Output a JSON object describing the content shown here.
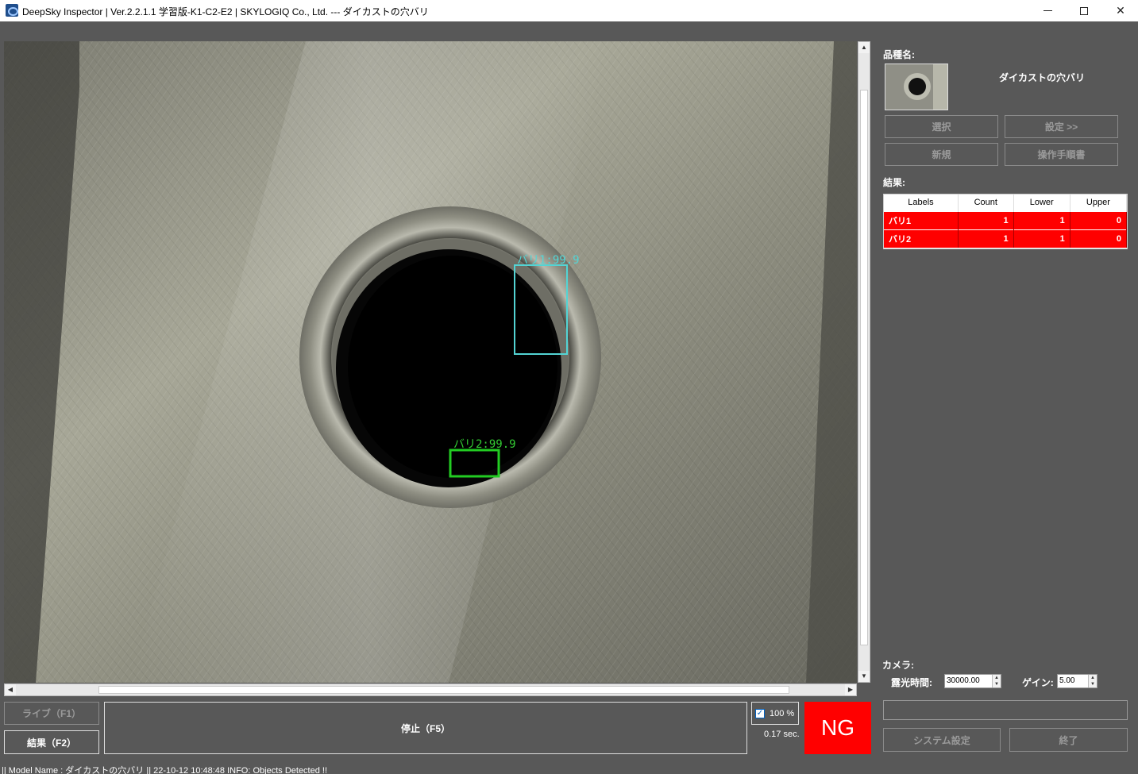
{
  "window": {
    "title": "DeepSky Inspector | Ver.2.2.1.1 学習版-K1-C2-E2 | SKYLOGIQ Co., Ltd. --- ダイカストの穴バリ",
    "minimize_icon": "minimize-icon",
    "maximize_icon": "maximize-icon",
    "close_glyph": "✕"
  },
  "viewer": {
    "detections": [
      {
        "label": "バリ1:99.9",
        "color": "#53d4d4"
      },
      {
        "label": "バリ2:99.9",
        "color": "#33cc33"
      }
    ]
  },
  "controls": {
    "live_label": "ライブ（F1）",
    "result_label": "結果（F2）",
    "stop_label": "停止（F5）",
    "zoom_label": "100 %",
    "zoom_checked": true,
    "time_label": "0.17 sec.",
    "judgement": "NG",
    "judgement_color": "#ff0000"
  },
  "panel": {
    "product_label": "品種名:",
    "product_name": "ダイカストの穴バリ",
    "select_label": "選択",
    "settings_label": "設定 >>",
    "new_label": "新規",
    "manual_label": "操作手順書",
    "results_label": "結果:",
    "columns": [
      "Labels",
      "Count",
      "Lower",
      "Upper"
    ],
    "rows": [
      {
        "label": "バリ1",
        "count": "1",
        "lower": "1",
        "upper": "0"
      },
      {
        "label": "バリ2",
        "count": "1",
        "lower": "1",
        "upper": "0"
      }
    ],
    "camera_label": "カメラ:",
    "exposure_label": "露光時間:",
    "exposure_value": "30000.00",
    "gain_label": "ゲイン:",
    "gain_value": "5.00",
    "system_label": "システム設定",
    "exit_label": "終了"
  },
  "statusbar": {
    "text": "|| Model Name : ダイカストの穴バリ ||    22-10-12 10:48:48   INFO:   Objects Detected !!"
  }
}
